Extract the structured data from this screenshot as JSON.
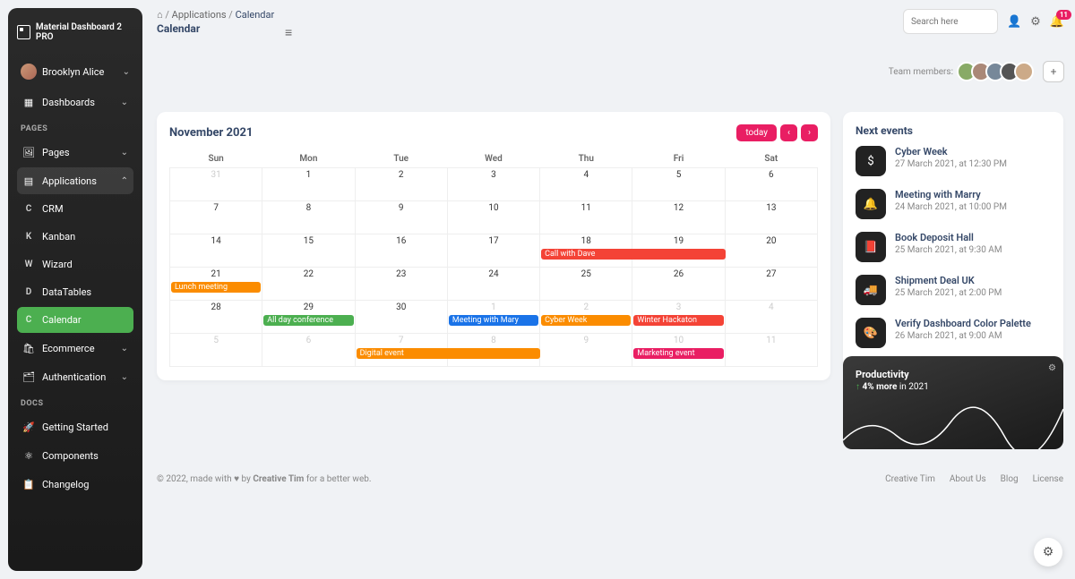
{
  "brand": "Material Dashboard 2 PRO",
  "user": {
    "name": "Brooklyn Alice"
  },
  "nav": {
    "dashboards": "Dashboards",
    "pages_label": "PAGES",
    "pages": "Pages",
    "applications": "Applications",
    "apps": {
      "crm": "CRM",
      "kanban": "Kanban",
      "wizard": "Wizard",
      "datatables": "DataTables",
      "calendar": "Calendar"
    },
    "ecommerce": "Ecommerce",
    "auth": "Authentication",
    "docs_label": "DOCS",
    "getting_started": "Getting Started",
    "components": "Components",
    "changelog": "Changelog"
  },
  "breadcrumb": {
    "root": "⌂",
    "l1": "Applications",
    "l2": "Calendar"
  },
  "page_title": "Calendar",
  "search_placeholder": "Search here",
  "notif_count": "11",
  "team_label": "Team members:",
  "calendar": {
    "title": "November 2021",
    "today": "today",
    "days": [
      "Sun",
      "Mon",
      "Tue",
      "Wed",
      "Thu",
      "Fri",
      "Sat"
    ],
    "weeks": [
      [
        {
          "d": "31",
          "m": 1
        },
        {
          "d": "1"
        },
        {
          "d": "2"
        },
        {
          "d": "3"
        },
        {
          "d": "4"
        },
        {
          "d": "5"
        },
        {
          "d": "6"
        }
      ],
      [
        {
          "d": "7"
        },
        {
          "d": "8"
        },
        {
          "d": "9"
        },
        {
          "d": "10"
        },
        {
          "d": "11"
        },
        {
          "d": "12"
        },
        {
          "d": "13"
        }
      ],
      [
        {
          "d": "14"
        },
        {
          "d": "15"
        },
        {
          "d": "16"
        },
        {
          "d": "17"
        },
        {
          "d": "18",
          "ev": [
            {
              "t": "Call with Dave",
              "c": "red",
              "span": 2
            }
          ]
        },
        {
          "d": "19"
        },
        {
          "d": "20"
        }
      ],
      [
        {
          "d": "21",
          "ev": [
            {
              "t": "Lunch meeting",
              "c": "orange",
              "span": 1
            }
          ]
        },
        {
          "d": "22"
        },
        {
          "d": "23"
        },
        {
          "d": "24"
        },
        {
          "d": "25"
        },
        {
          "d": "26"
        },
        {
          "d": "27"
        }
      ],
      [
        {
          "d": "28"
        },
        {
          "d": "29",
          "ev": [
            {
              "t": "All day conference",
              "c": "green",
              "span": 1
            }
          ]
        },
        {
          "d": "30"
        },
        {
          "d": "1",
          "m": 1,
          "ev": [
            {
              "t": "Meeting with Mary",
              "c": "blue",
              "span": 1
            }
          ]
        },
        {
          "d": "2",
          "m": 1,
          "ev": [
            {
              "t": "Cyber Week",
              "c": "orange",
              "span": 1
            }
          ]
        },
        {
          "d": "3",
          "m": 1,
          "ev": [
            {
              "t": "Winter Hackaton",
              "c": "red",
              "span": 1
            }
          ]
        },
        {
          "d": "4",
          "m": 1
        }
      ],
      [
        {
          "d": "5",
          "m": 1
        },
        {
          "d": "6",
          "m": 1
        },
        {
          "d": "7",
          "m": 1,
          "ev": [
            {
              "t": "Digital event",
              "c": "orange",
              "span": 2
            }
          ]
        },
        {
          "d": "8",
          "m": 1
        },
        {
          "d": "9",
          "m": 1
        },
        {
          "d": "10",
          "m": 1,
          "ev": [
            {
              "t": "Marketing event",
              "c": "pink",
              "span": 1
            }
          ]
        },
        {
          "d": "11",
          "m": 1
        }
      ]
    ]
  },
  "next_events": {
    "title": "Next events",
    "items": [
      {
        "icon": "$",
        "name": "Cyber Week",
        "date": "27 March 2021, at 12:30 PM"
      },
      {
        "icon": "🔔",
        "name": "Meeting with Marry",
        "date": "24 March 2021, at 10:00 PM"
      },
      {
        "icon": "📕",
        "name": "Book Deposit Hall",
        "date": "25 March 2021, at 9:30 AM"
      },
      {
        "icon": "🚚",
        "name": "Shipment Deal UK",
        "date": "25 March 2021, at 2:00 PM"
      },
      {
        "icon": "🎨",
        "name": "Verify Dashboard Color Palette",
        "date": "26 March 2021, at 9:00 AM"
      }
    ]
  },
  "productivity": {
    "title": "Productivity",
    "delta": "4% more",
    "year": "in 2021"
  },
  "footer": {
    "copy_prefix": "© 2022, made with ",
    "heart": "♥",
    "by": " by ",
    "author": "Creative Tim",
    "suffix": " for a better web.",
    "links": [
      "Creative Tim",
      "About Us",
      "Blog",
      "License"
    ]
  }
}
